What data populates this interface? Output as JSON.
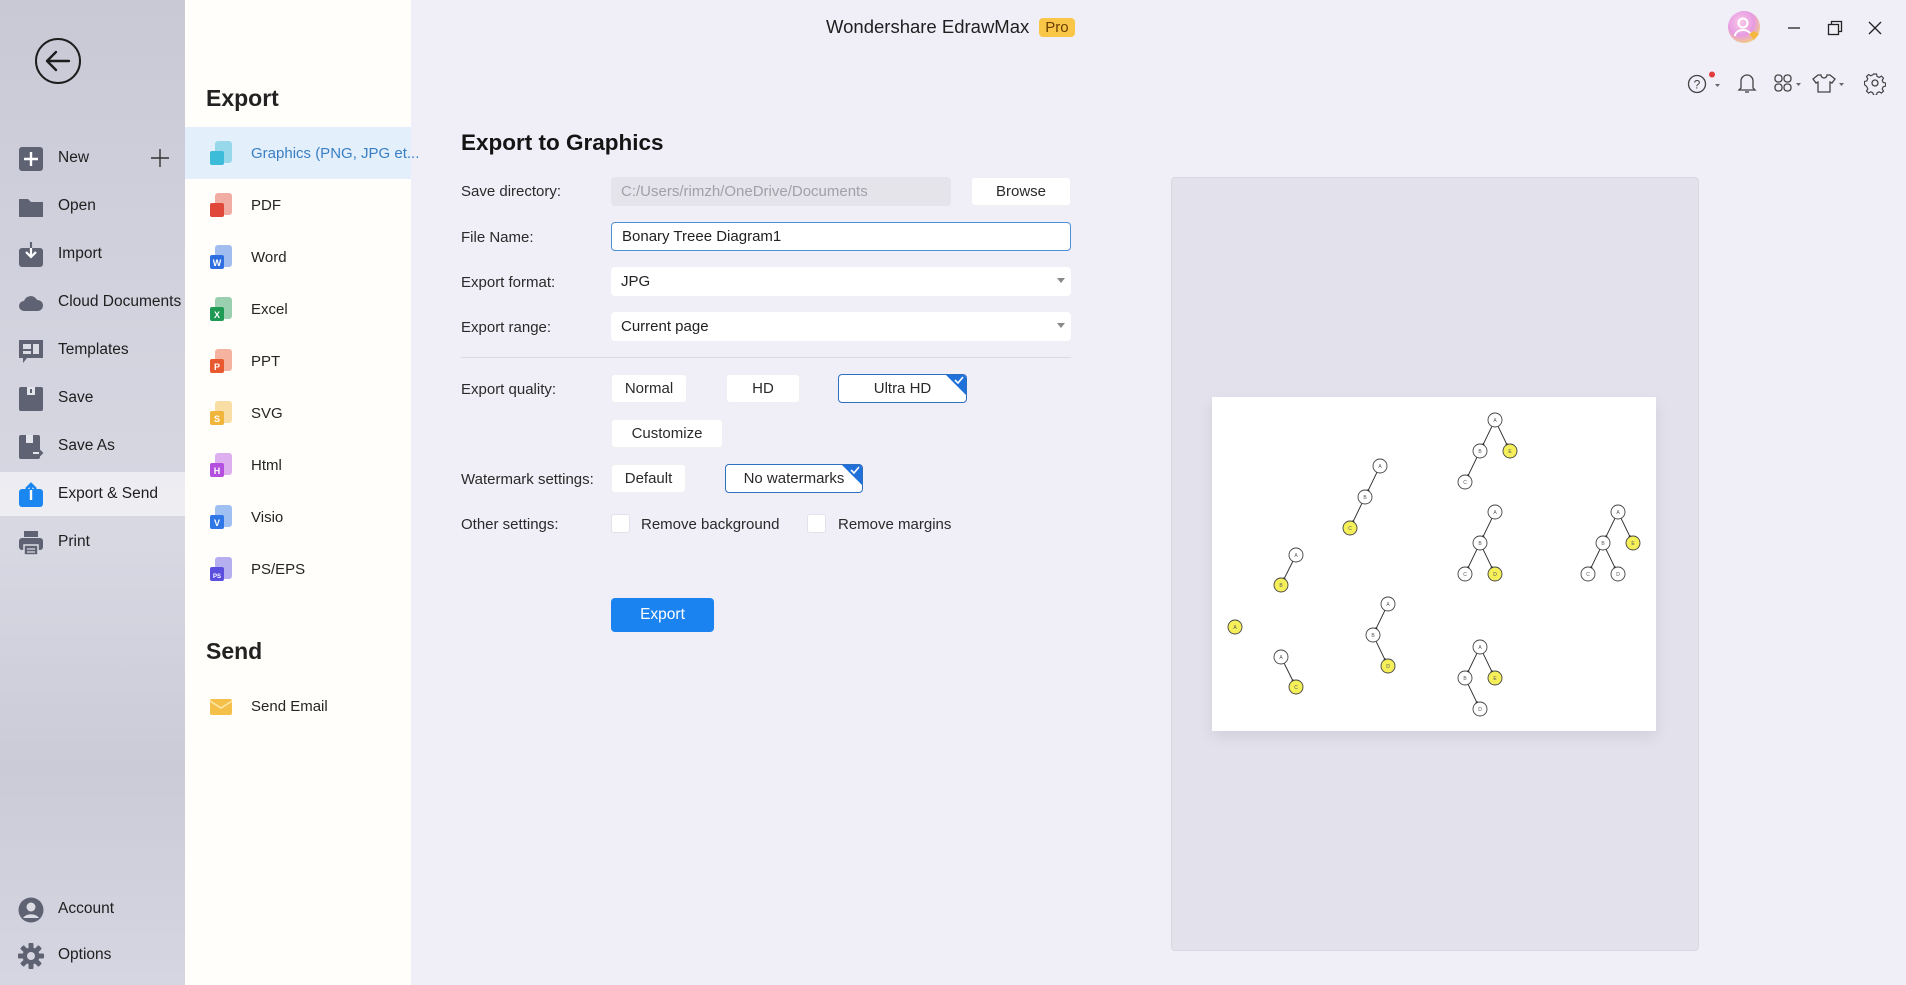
{
  "window": {
    "app_title": "Wondershare EdrawMax",
    "badge": "Pro"
  },
  "nav": {
    "back_icon": "back-arrow-icon",
    "items": [
      {
        "label": "New",
        "icon": "new-icon"
      },
      {
        "label": "Open",
        "icon": "folder-icon"
      },
      {
        "label": "Import",
        "icon": "import-icon"
      },
      {
        "label": "Cloud Documents",
        "icon": "cloud-icon"
      },
      {
        "label": "Templates",
        "icon": "templates-icon"
      },
      {
        "label": "Save",
        "icon": "save-icon"
      },
      {
        "label": "Save As",
        "icon": "save-as-icon"
      },
      {
        "label": "Export & Send",
        "icon": "export-icon",
        "active": true
      },
      {
        "label": "Print",
        "icon": "print-icon"
      }
    ],
    "bottom": [
      {
        "label": "Account",
        "icon": "account-icon"
      },
      {
        "label": "Options",
        "icon": "options-gear-icon"
      }
    ]
  },
  "export_panel": {
    "heading": "Export",
    "formats": [
      {
        "label": "Graphics (PNG, JPG et...",
        "icon": "graphics-file-icon",
        "color": "#3cbcd8",
        "active": true
      },
      {
        "label": "PDF",
        "icon": "pdf-file-icon",
        "color": "#e0493a"
      },
      {
        "label": "Word",
        "icon": "word-file-icon",
        "color": "#2f6ee0"
      },
      {
        "label": "Excel",
        "icon": "excel-file-icon",
        "color": "#1f9a55"
      },
      {
        "label": "PPT",
        "icon": "ppt-file-icon",
        "color": "#e8592f"
      },
      {
        "label": "SVG",
        "icon": "svg-file-icon",
        "color": "#f0b53a"
      },
      {
        "label": "Html",
        "icon": "html-file-icon",
        "color": "#b44fe0"
      },
      {
        "label": "Visio",
        "icon": "visio-file-icon",
        "color": "#2f76e6"
      },
      {
        "label": "PS/EPS",
        "icon": "ps-eps-file-icon",
        "color": "#5b4fe0"
      }
    ],
    "send_heading": "Send",
    "send_items": [
      {
        "label": "Send Email",
        "icon": "email-icon",
        "color": "#f5c04a"
      }
    ]
  },
  "form": {
    "title": "Export to Graphics",
    "save_directory_label": "Save directory:",
    "save_directory_value": "C:/Users/rimzh/OneDrive/Documents",
    "browse_label": "Browse",
    "file_name_label": "File Name:",
    "file_name_value": "Bonary Treee Diagram1",
    "export_format_label": "Export format:",
    "export_format_value": "JPG",
    "export_range_label": "Export range:",
    "export_range_value": "Current page",
    "export_quality_label": "Export quality:",
    "quality_options": [
      "Normal",
      "HD",
      "Ultra HD",
      "Customize"
    ],
    "quality_selected": "Ultra HD",
    "watermark_label": "Watermark settings:",
    "watermark_options": [
      "Default",
      "No watermarks"
    ],
    "watermark_selected": "No watermarks",
    "other_settings_label": "Other settings:",
    "remove_background_label": "Remove background",
    "remove_background_checked": false,
    "remove_margins_label": "Remove margins",
    "remove_margins_checked": false,
    "export_button": "Export"
  },
  "toolbar": {
    "icons": [
      "help-icon",
      "notification-bell-icon",
      "apps-grid-icon",
      "theme-shirt-icon",
      "settings-gear-icon"
    ],
    "help_has_notification": true
  },
  "preview": {
    "highlight_color": "#f5ef5a",
    "trees": [
      {
        "nodes": [
          {
            "id": "A",
            "label": "A",
            "hl": true
          }
        ],
        "edges": []
      },
      {
        "nodes": [
          {
            "id": "A",
            "label": "A"
          },
          {
            "id": "B",
            "label": "B",
            "hl": true
          }
        ],
        "edges": [
          [
            "A",
            "B"
          ]
        ]
      },
      {
        "nodes": [
          {
            "id": "A",
            "label": "A"
          },
          {
            "id": "C",
            "label": "C",
            "hl": true
          }
        ],
        "edges": [
          [
            "A",
            "C"
          ]
        ]
      },
      {
        "nodes": [
          {
            "id": "A",
            "label": "A"
          },
          {
            "id": "B",
            "label": "B"
          },
          {
            "id": "C",
            "label": "C",
            "hl": true
          }
        ],
        "edges": [
          [
            "A",
            "B"
          ],
          [
            "B",
            "C"
          ]
        ]
      },
      {
        "nodes": [
          {
            "id": "A",
            "label": "A"
          },
          {
            "id": "B",
            "label": "B"
          },
          {
            "id": "D",
            "label": "D",
            "hl": true
          }
        ],
        "edges": [
          [
            "A",
            "B"
          ],
          [
            "B",
            "D"
          ]
        ]
      },
      {
        "nodes": [
          {
            "id": "A",
            "label": "A"
          },
          {
            "id": "B",
            "label": "B"
          },
          {
            "id": "E",
            "label": "E",
            "hl": true
          },
          {
            "id": "C",
            "label": "C"
          }
        ],
        "edges": [
          [
            "A",
            "B"
          ],
          [
            "A",
            "E"
          ],
          [
            "B",
            "C"
          ]
        ]
      },
      {
        "nodes": [
          {
            "id": "A",
            "label": "A"
          },
          {
            "id": "B",
            "label": "B"
          },
          {
            "id": "C",
            "label": "C"
          },
          {
            "id": "D",
            "label": "D",
            "hl": true
          }
        ],
        "edges": [
          [
            "A",
            "B"
          ],
          [
            "B",
            "C"
          ],
          [
            "B",
            "D"
          ]
        ]
      },
      {
        "nodes": [
          {
            "id": "A",
            "label": "A"
          },
          {
            "id": "B",
            "label": "B"
          },
          {
            "id": "E",
            "label": "E",
            "hl": true
          },
          {
            "id": "C",
            "label": "C"
          },
          {
            "id": "D",
            "label": "D"
          }
        ],
        "edges": [
          [
            "A",
            "B"
          ],
          [
            "A",
            "E"
          ],
          [
            "B",
            "C"
          ],
          [
            "B",
            "D"
          ]
        ]
      },
      {
        "nodes": [
          {
            "id": "A",
            "label": "A"
          },
          {
            "id": "B",
            "label": "B"
          },
          {
            "id": "E",
            "label": "E",
            "hl": true
          },
          {
            "id": "D",
            "label": "D"
          }
        ],
        "edges": [
          [
            "A",
            "B"
          ],
          [
            "A",
            "E"
          ],
          [
            "B",
            "D"
          ]
        ]
      }
    ]
  }
}
